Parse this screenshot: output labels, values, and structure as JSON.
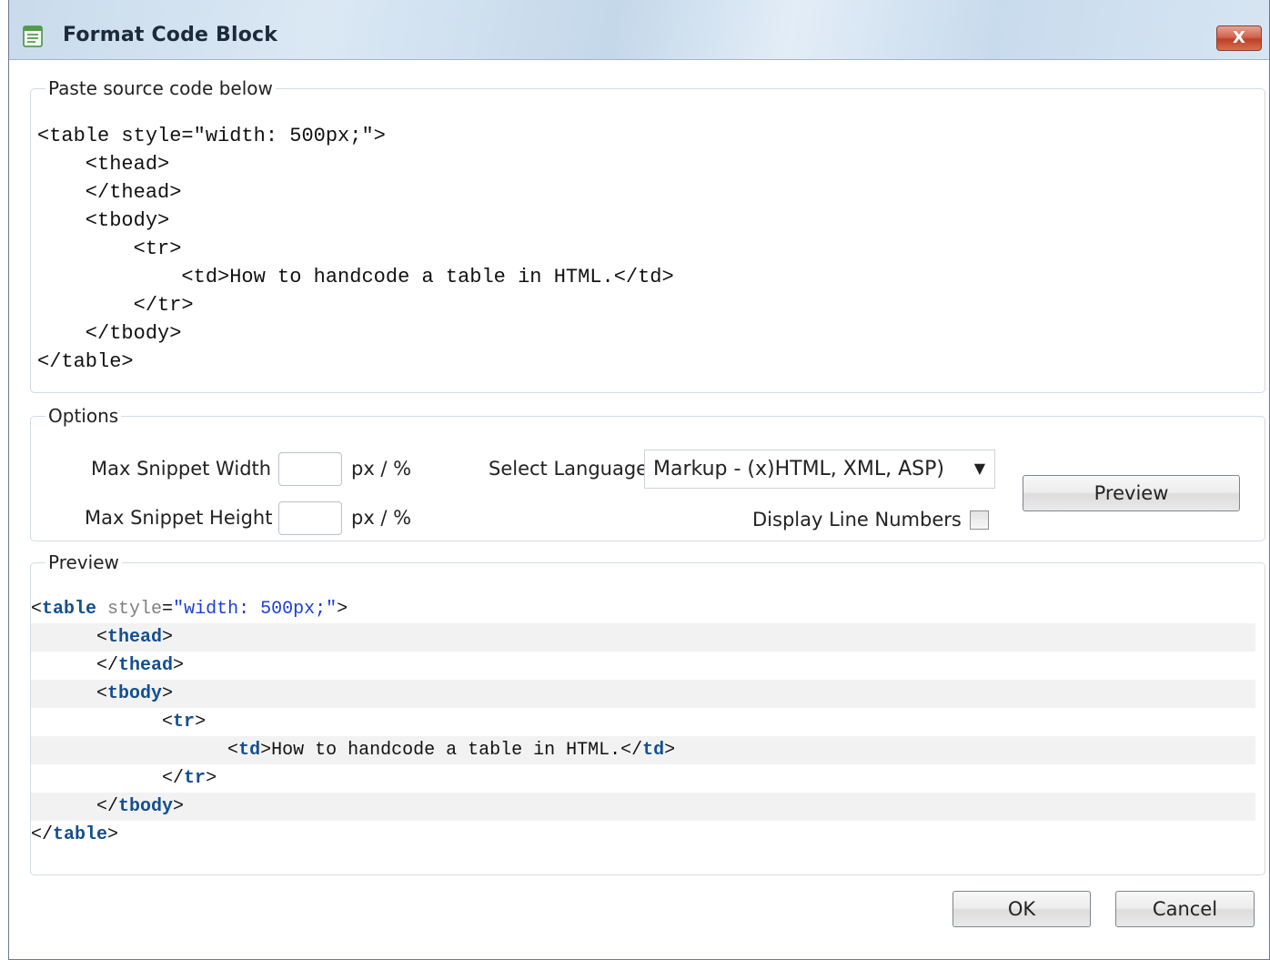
{
  "dialog": {
    "title": "Format Code Block",
    "close_label": "X"
  },
  "source": {
    "legend": "Paste source code below",
    "lines": [
      "<table style=\"width: 500px;\">",
      "    <thead>",
      "    </thead>",
      "    <tbody>",
      "        <tr>",
      "            <td>How to handcode a table in HTML.</td>",
      "        </tr>",
      "    </tbody>",
      "</table>"
    ]
  },
  "options": {
    "legend": "Options",
    "max_width_label": "Max Snippet Width",
    "max_width_value": "",
    "max_height_label": "Max Snippet Height",
    "max_height_value": "",
    "unit_label": "px / %",
    "language_label": "Select Language",
    "language_selected": "Markup - (x)HTML, XML, ASP)",
    "line_numbers_label": "Display Line Numbers",
    "line_numbers_checked": false,
    "preview_button": "Preview"
  },
  "preview": {
    "legend": "Preview",
    "lines": [
      {
        "indent": "",
        "tokens": [
          {
            "t": "<",
            "c": ""
          },
          {
            "t": "table",
            "c": "tag"
          },
          {
            "t": " style",
            "c": "attr"
          },
          {
            "t": "=",
            "c": ""
          },
          {
            "t": "\"width: 500px;\"",
            "c": "str"
          },
          {
            "t": ">",
            "c": ""
          }
        ]
      },
      {
        "indent": "      ",
        "tokens": [
          {
            "t": "<",
            "c": ""
          },
          {
            "t": "thead",
            "c": "tag"
          },
          {
            "t": ">",
            "c": ""
          }
        ]
      },
      {
        "indent": "      ",
        "tokens": [
          {
            "t": "</",
            "c": ""
          },
          {
            "t": "thead",
            "c": "tag"
          },
          {
            "t": ">",
            "c": ""
          }
        ]
      },
      {
        "indent": "      ",
        "tokens": [
          {
            "t": "<",
            "c": ""
          },
          {
            "t": "tbody",
            "c": "tag"
          },
          {
            "t": ">",
            "c": ""
          }
        ]
      },
      {
        "indent": "            ",
        "tokens": [
          {
            "t": "<",
            "c": ""
          },
          {
            "t": "tr",
            "c": "tag"
          },
          {
            "t": ">",
            "c": ""
          }
        ]
      },
      {
        "indent": "                  ",
        "tokens": [
          {
            "t": "<",
            "c": ""
          },
          {
            "t": "td",
            "c": "tag"
          },
          {
            "t": ">How to handcode a table in HTML.</",
            "c": ""
          },
          {
            "t": "td",
            "c": "tag"
          },
          {
            "t": ">",
            "c": ""
          }
        ]
      },
      {
        "indent": "            ",
        "tokens": [
          {
            "t": "</",
            "c": ""
          },
          {
            "t": "tr",
            "c": "tag"
          },
          {
            "t": ">",
            "c": ""
          }
        ]
      },
      {
        "indent": "      ",
        "tokens": [
          {
            "t": "</",
            "c": ""
          },
          {
            "t": "tbody",
            "c": "tag"
          },
          {
            "t": ">",
            "c": ""
          }
        ]
      },
      {
        "indent": "",
        "tokens": [
          {
            "t": "</",
            "c": ""
          },
          {
            "t": "table",
            "c": "tag"
          },
          {
            "t": ">",
            "c": ""
          }
        ]
      }
    ]
  },
  "footer": {
    "ok_label": "OK",
    "cancel_label": "Cancel"
  },
  "colors": {
    "tag": "#134f8f",
    "attribute": "#808080",
    "string": "#1a3fd6",
    "alt_row": "#f2f2f2"
  }
}
